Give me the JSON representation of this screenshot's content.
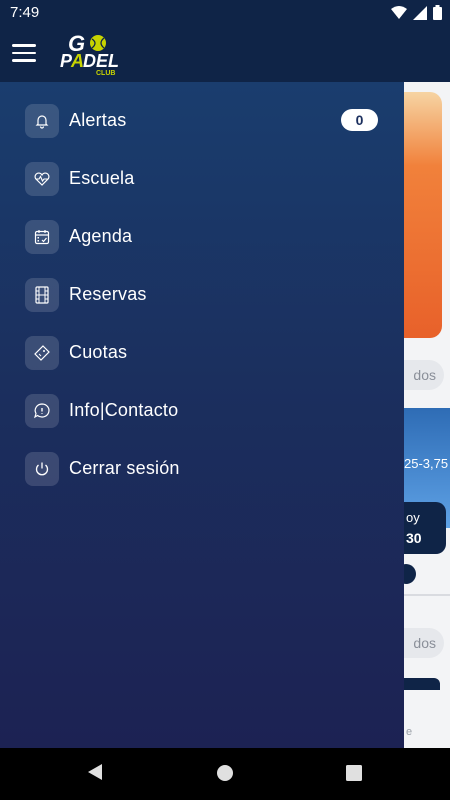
{
  "status_bar": {
    "time": "7:49"
  },
  "app_bar": {
    "logo_text_go": "GO",
    "logo_text_padel": "PADEL",
    "logo_text_club": "CLUB"
  },
  "drawer": {
    "items": [
      {
        "label": "Alertas",
        "icon": "bell-icon",
        "badge": "0"
      },
      {
        "label": "Escuela",
        "icon": "heart-pulse-icon"
      },
      {
        "label": "Agenda",
        "icon": "calendar-check-icon"
      },
      {
        "label": "Reservas",
        "icon": "film-court-icon"
      },
      {
        "label": "Cuotas",
        "icon": "ticket-tag-icon"
      },
      {
        "label": "Info|Contacto",
        "icon": "chat-bubble-icon"
      },
      {
        "label": "Cerrar sesión",
        "icon": "power-icon"
      }
    ]
  },
  "background_content": {
    "chip_1": "dos",
    "court_text": "25-3,75",
    "badge_line1": "oy",
    "badge_line2": "30",
    "chip_2": "dos",
    "footer_letter": "e"
  },
  "colors": {
    "primary": "#0f2447",
    "accent": "#c8d400",
    "drawer_top": "#1a3d6e",
    "drawer_bottom": "#1c2253"
  }
}
